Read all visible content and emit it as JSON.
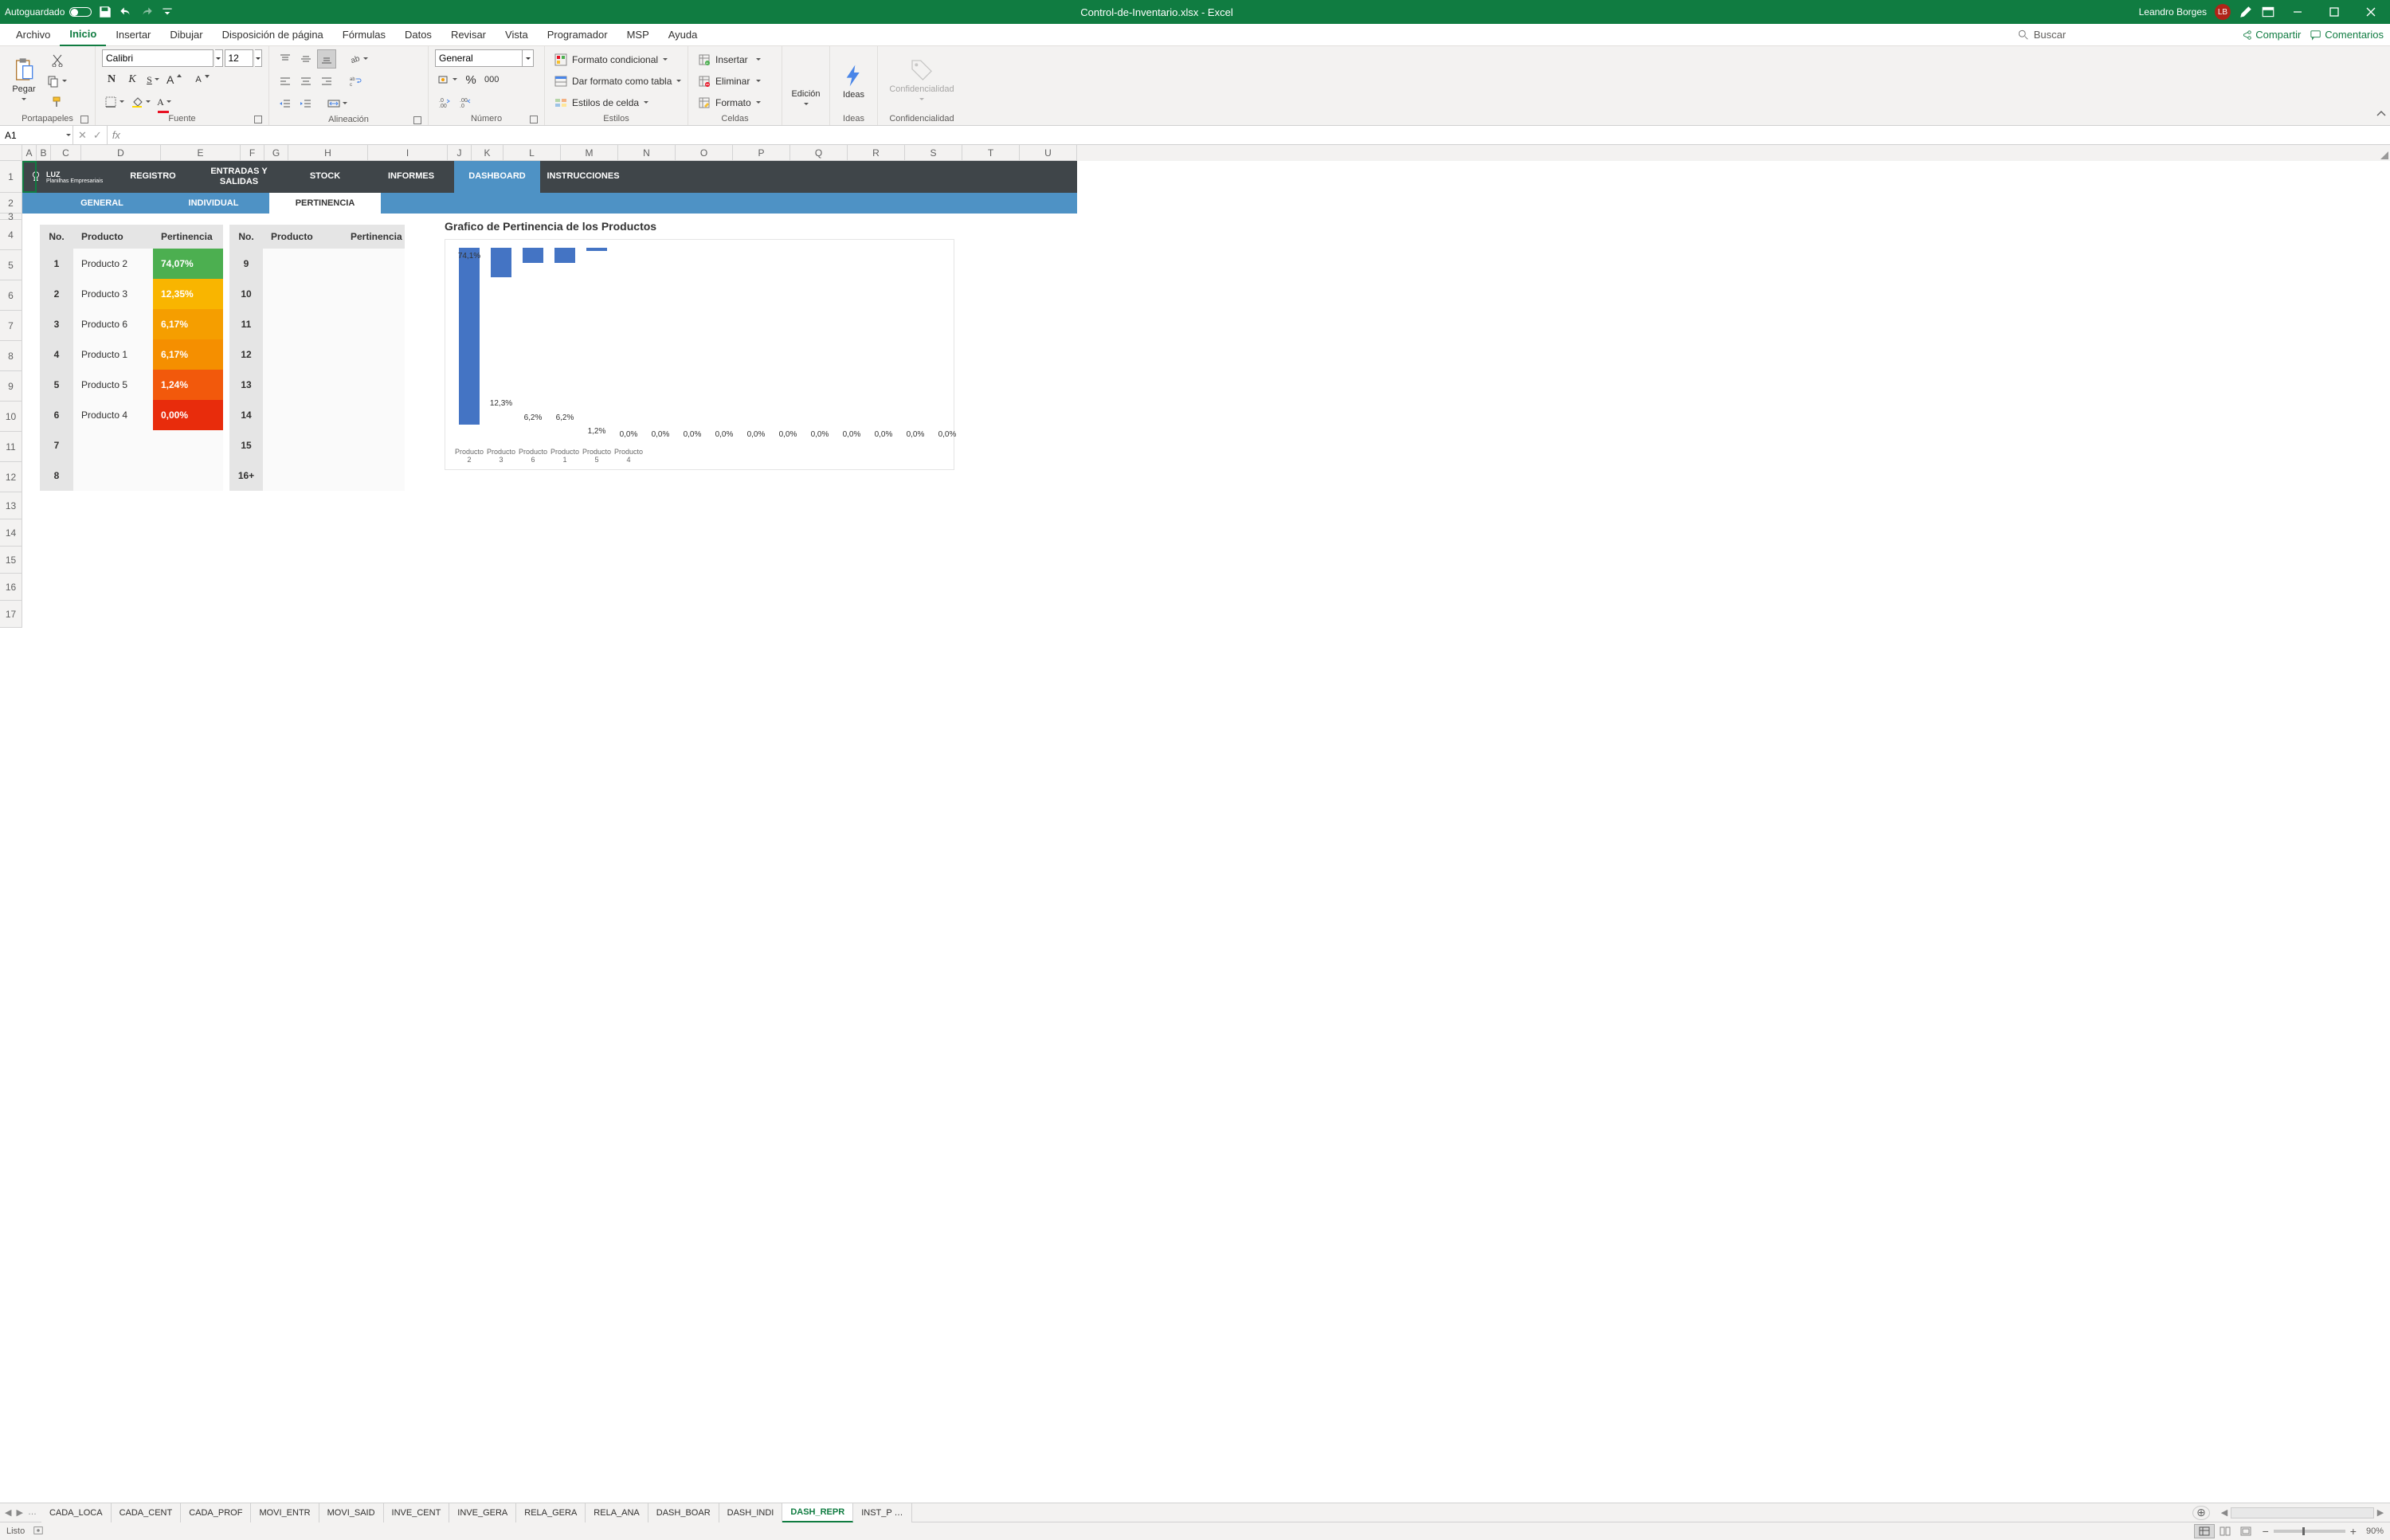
{
  "titlebar": {
    "autosave": "Autoguardado",
    "docname": "Control-de-Inventario.xlsx  -  Excel",
    "user": "Leandro Borges",
    "initials": "LB"
  },
  "menu": {
    "tabs": [
      "Archivo",
      "Inicio",
      "Insertar",
      "Dibujar",
      "Disposición de página",
      "Fórmulas",
      "Datos",
      "Revisar",
      "Vista",
      "Programador",
      "MSP",
      "Ayuda"
    ],
    "active": 1,
    "search_ph": "Buscar",
    "share": "Compartir",
    "comments": "Comentarios"
  },
  "ribbon": {
    "paste": "Pegar",
    "clipboard": "Portapapeles",
    "font_name": "Calibri",
    "font_size": "12",
    "font_grp": "Fuente",
    "align_grp": "Alineación",
    "num_format": "General",
    "num_grp": "Número",
    "num_000": "000",
    "cond_fmt": "Formato condicional",
    "tbl_fmt": "Dar formato como tabla",
    "cell_styles": "Estilos de celda",
    "styles_grp": "Estilos",
    "insert": "Insertar",
    "delete": "Eliminar",
    "format": "Formato",
    "cells_grp": "Celdas",
    "editing": "Edición",
    "ideas": "Ideas",
    "ideas_grp": "Ideas",
    "conf": "Confidencialidad",
    "conf_grp": "Confidencialidad"
  },
  "formula": {
    "cell_ref": "A1",
    "formula": ""
  },
  "columns": [
    {
      "l": "A",
      "w": 18
    },
    {
      "l": "B",
      "w": 18
    },
    {
      "l": "C",
      "w": 38
    },
    {
      "l": "D",
      "w": 100
    },
    {
      "l": "E",
      "w": 100
    },
    {
      "l": "F",
      "w": 30
    },
    {
      "l": "G",
      "w": 30
    },
    {
      "l": "H",
      "w": 100
    },
    {
      "l": "I",
      "w": 100
    },
    {
      "l": "J",
      "w": 30
    },
    {
      "l": "K",
      "w": 40
    },
    {
      "l": "L",
      "w": 72
    },
    {
      "l": "M",
      "w": 72
    },
    {
      "l": "N",
      "w": 72
    },
    {
      "l": "O",
      "w": 72
    },
    {
      "l": "P",
      "w": 72
    },
    {
      "l": "Q",
      "w": 72
    },
    {
      "l": "R",
      "w": 72
    },
    {
      "l": "S",
      "w": 72
    },
    {
      "l": "T",
      "w": 72
    },
    {
      "l": "U",
      "w": 72
    }
  ],
  "row_labels": [
    "1",
    "2",
    "3",
    "4",
    "5",
    "6",
    "7",
    "8",
    "9",
    "10",
    "11",
    "12",
    "13",
    "14",
    "15",
    "16",
    "17"
  ],
  "row_classes": [
    "r1",
    "r2",
    "r3",
    "rdata",
    "rdata",
    "rdata",
    "rdata",
    "rdata",
    "rdata",
    "rdata",
    "rdata",
    "rdata",
    "rspace",
    "rspace",
    "rspace",
    "rspace",
    "rspace"
  ],
  "dash": {
    "logo_top": "LUZ",
    "logo_sub": "Planilhas Empresariais",
    "tabs": [
      "REGISTRO",
      "ENTRADAS Y SALIDAS",
      "STOCK",
      "INFORMES",
      "DASHBOARD",
      "INSTRUCCIONES"
    ],
    "active": 4,
    "subtabs": [
      "GENERAL",
      "INDIVIDUAL",
      "PERTINENCIA"
    ],
    "sub_active": 2
  },
  "table_headers": {
    "no": "No.",
    "prod": "Producto",
    "pert": "Pertinencia"
  },
  "table_left": [
    {
      "no": "1",
      "prod": "Producto 2",
      "pert": "74,07%",
      "color": "#4caf50"
    },
    {
      "no": "2",
      "prod": "Producto 3",
      "pert": "12,35%",
      "color": "#f9b500"
    },
    {
      "no": "3",
      "prod": "Producto 6",
      "pert": "6,17%",
      "color": "#f59e00"
    },
    {
      "no": "4",
      "prod": "Producto 1",
      "pert": "6,17%",
      "color": "#f58f00"
    },
    {
      "no": "5",
      "prod": "Producto 5",
      "pert": "1,24%",
      "color": "#f2590c"
    },
    {
      "no": "6",
      "prod": "Producto 4",
      "pert": "0,00%",
      "color": "#e82c0c"
    },
    {
      "no": "7",
      "prod": "",
      "pert": "",
      "color": ""
    },
    {
      "no": "8",
      "prod": "",
      "pert": "",
      "color": ""
    }
  ],
  "table_right": [
    {
      "no": "9"
    },
    {
      "no": "10"
    },
    {
      "no": "11"
    },
    {
      "no": "12"
    },
    {
      "no": "13"
    },
    {
      "no": "14"
    },
    {
      "no": "15"
    },
    {
      "no": "16+"
    }
  ],
  "chart_data": {
    "type": "bar",
    "title": "Grafico de Pertinencia de los Productos",
    "categories": [
      "Producto 2",
      "Producto 3",
      "Producto 6",
      "Producto 1",
      "Producto 5",
      "Producto 4",
      "",
      "",
      "",
      "",
      "",
      "",
      "",
      "",
      "",
      ""
    ],
    "values": [
      74.1,
      12.3,
      6.2,
      6.2,
      1.2,
      0.0,
      0.0,
      0.0,
      0.0,
      0.0,
      0.0,
      0.0,
      0.0,
      0.0,
      0.0,
      0.0
    ],
    "value_labels": [
      "74,1%",
      "12,3%",
      "6,2%",
      "6,2%",
      "1,2%",
      "0,0%",
      "0,0%",
      "0,0%",
      "0,0%",
      "0,0%",
      "0,0%",
      "0,0%",
      "0,0%",
      "0,0%",
      "0,0%",
      "0,0%"
    ],
    "ylim": [
      0,
      80
    ]
  },
  "sheets": {
    "list": [
      "CADA_LOCA",
      "CADA_CENT",
      "CADA_PROF",
      "MOVI_ENTR",
      "MOVI_SAID",
      "INVE_CENT",
      "INVE_GERA",
      "RELA_GERA",
      "RELA_ANA",
      "DASH_BOAR",
      "DASH_INDI",
      "DASH_REPR",
      "INST_P …"
    ],
    "active": 11,
    "more": "…"
  },
  "status": {
    "ready": "Listo",
    "zoom": "90%"
  }
}
